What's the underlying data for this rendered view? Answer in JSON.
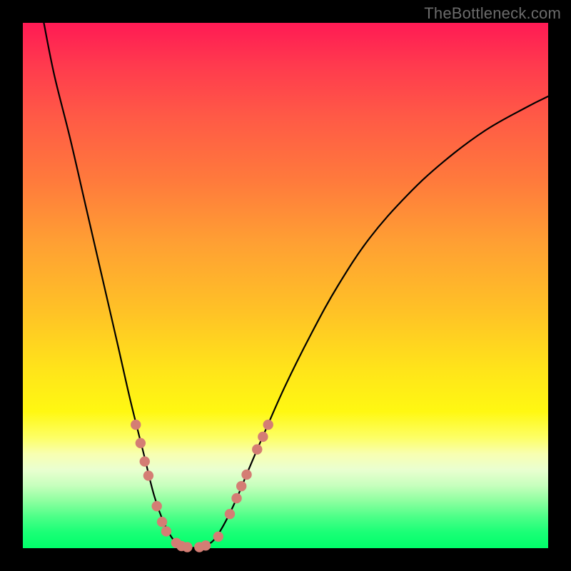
{
  "watermark": "TheBottleneck.com",
  "chart_data": {
    "type": "line",
    "title": "",
    "xlabel": "",
    "ylabel": "",
    "xlim": [
      0,
      100
    ],
    "ylim": [
      0,
      100
    ],
    "grid": false,
    "series": [
      {
        "name": "bottleneck-curve",
        "points": [
          {
            "x": 4.0,
            "y": 100.0
          },
          {
            "x": 6.0,
            "y": 90.0
          },
          {
            "x": 9.0,
            "y": 78.0
          },
          {
            "x": 12.0,
            "y": 65.0
          },
          {
            "x": 15.0,
            "y": 52.0
          },
          {
            "x": 18.0,
            "y": 39.0
          },
          {
            "x": 20.5,
            "y": 28.0
          },
          {
            "x": 23.0,
            "y": 18.0
          },
          {
            "x": 25.0,
            "y": 10.0
          },
          {
            "x": 27.0,
            "y": 4.5
          },
          {
            "x": 29.0,
            "y": 1.2
          },
          {
            "x": 31.0,
            "y": 0.2
          },
          {
            "x": 33.5,
            "y": 0.2
          },
          {
            "x": 36.0,
            "y": 1.2
          },
          {
            "x": 38.0,
            "y": 4.0
          },
          {
            "x": 40.5,
            "y": 9.0
          },
          {
            "x": 43.0,
            "y": 15.0
          },
          {
            "x": 46.0,
            "y": 22.0
          },
          {
            "x": 50.0,
            "y": 31.0
          },
          {
            "x": 55.0,
            "y": 41.0
          },
          {
            "x": 60.0,
            "y": 50.0
          },
          {
            "x": 66.0,
            "y": 59.0
          },
          {
            "x": 73.0,
            "y": 67.0
          },
          {
            "x": 80.0,
            "y": 73.5
          },
          {
            "x": 88.0,
            "y": 79.5
          },
          {
            "x": 96.0,
            "y": 84.0
          },
          {
            "x": 100.0,
            "y": 86.0
          }
        ]
      }
    ],
    "markers": [
      {
        "x": 21.5,
        "y": 23.5
      },
      {
        "x": 22.4,
        "y": 20.0
      },
      {
        "x": 23.2,
        "y": 16.5
      },
      {
        "x": 23.9,
        "y": 13.8
      },
      {
        "x": 25.5,
        "y": 8.0
      },
      {
        "x": 26.5,
        "y": 5.0
      },
      {
        "x": 27.3,
        "y": 3.2
      },
      {
        "x": 29.2,
        "y": 1.0
      },
      {
        "x": 30.2,
        "y": 0.4
      },
      {
        "x": 31.3,
        "y": 0.2
      },
      {
        "x": 33.6,
        "y": 0.2
      },
      {
        "x": 34.8,
        "y": 0.5
      },
      {
        "x": 37.2,
        "y": 2.2
      },
      {
        "x": 39.4,
        "y": 6.5
      },
      {
        "x": 40.7,
        "y": 9.5
      },
      {
        "x": 41.6,
        "y": 11.8
      },
      {
        "x": 42.6,
        "y": 14.0
      },
      {
        "x": 44.6,
        "y": 18.8
      },
      {
        "x": 45.7,
        "y": 21.2
      },
      {
        "x": 46.7,
        "y": 23.5
      }
    ],
    "marker_radius_px": 7.2,
    "marker_color": "#d47d74",
    "background": {
      "type": "vertical-gradient",
      "stops": [
        {
          "pos": 0.0,
          "color": "#ff1a54"
        },
        {
          "pos": 0.3,
          "color": "#ff7a3c"
        },
        {
          "pos": 0.66,
          "color": "#ffe41a"
        },
        {
          "pos": 0.82,
          "color": "#f8ffb0"
        },
        {
          "pos": 1.0,
          "color": "#00ff6a"
        }
      ]
    }
  }
}
